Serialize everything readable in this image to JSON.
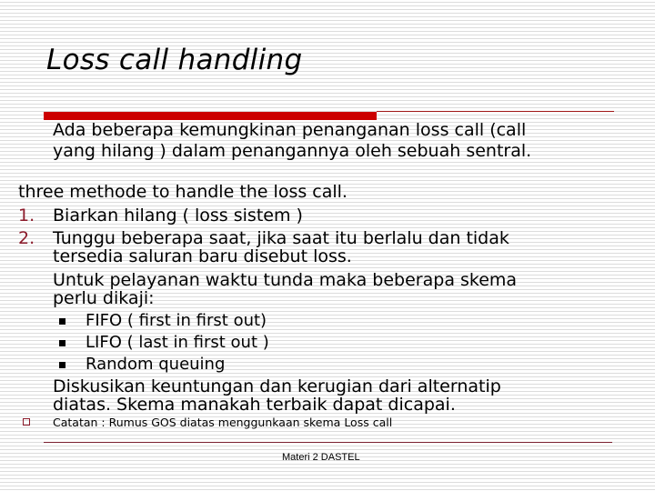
{
  "title": "Loss call handling",
  "intro": {
    "lines": [
      "Ada beberapa kemungkinan penanganan loss call (call",
      "yang hilang )  dalam penangannya oleh sebuah sentral."
    ]
  },
  "lead": "three methode to handle the loss call.",
  "methods": [
    {
      "number": "1.",
      "lines": [
        "Biarkan hilang ( loss sistem )"
      ]
    },
    {
      "number": "2.",
      "lines": [
        "Tunggu beberapa saat, jika saat itu berlalu dan tidak",
        "tersedia saluran baru disebut loss."
      ],
      "followup": [
        "Untuk pelayanan waktu tunda maka beberapa skema",
        "perlu dikaji:"
      ],
      "schemes": [
        "FIFO ( first in first out)",
        "LIFO ( last in first out )",
        "Random queuing"
      ],
      "discussion": [
        "Diskusikan keuntungan dan kerugian dari alternatip",
        "diatas.  Skema manakah terbaik dapat dicapai."
      ]
    }
  ],
  "note": "Catatan : Rumus  GOS diatas menggunkaan skema  Loss call",
  "footer": "Materi 2 DASTEL",
  "colors": {
    "accent_red": "#cc0000",
    "number_red": "#8b1a2a",
    "stripe_gray": "#dcdcdc"
  },
  "icons": {
    "scheme_bullet": "filled-square-icon",
    "note_bullet": "hollow-square-icon"
  }
}
